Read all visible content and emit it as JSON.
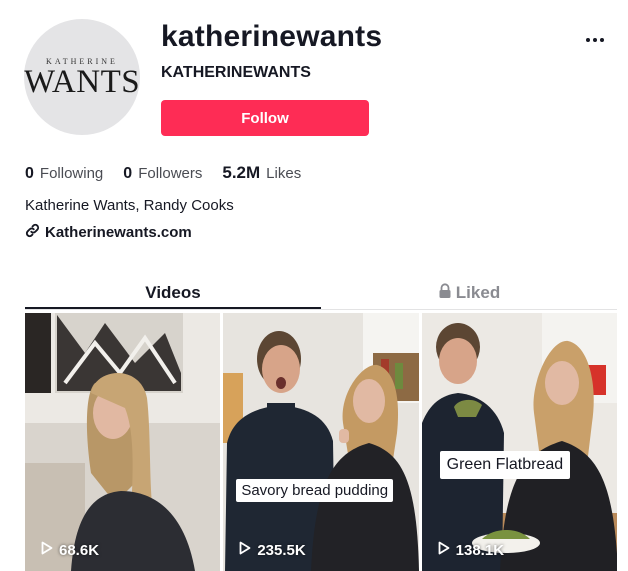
{
  "profile": {
    "username": "katherinewants",
    "nickname": "KATHERINEWANTS",
    "avatar_logo_top": "KATHERINE",
    "avatar_logo_bottom": "WANTS",
    "follow_label": "Follow",
    "bio": "Katherine Wants, Randy Cooks",
    "link": "Katherinewants.com"
  },
  "stats": {
    "following_count": "0",
    "following_label": "Following",
    "followers_count": "0",
    "followers_label": "Followers",
    "likes_count": "5.2M",
    "likes_label": "Likes"
  },
  "tabs": {
    "videos": "Videos",
    "liked": "Liked"
  },
  "videos": [
    {
      "views": "68.6K",
      "caption": ""
    },
    {
      "views": "235.5K",
      "caption": "Savory bread pudding"
    },
    {
      "views": "138.1K",
      "caption": "Green Flatbread"
    }
  ],
  "colors": {
    "accent": "#fe2c55",
    "text": "#161823",
    "muted": "#8a8b91"
  },
  "icons": {
    "more": "more-icon",
    "link": "link-icon",
    "lock": "lock-icon",
    "play": "play-icon"
  }
}
